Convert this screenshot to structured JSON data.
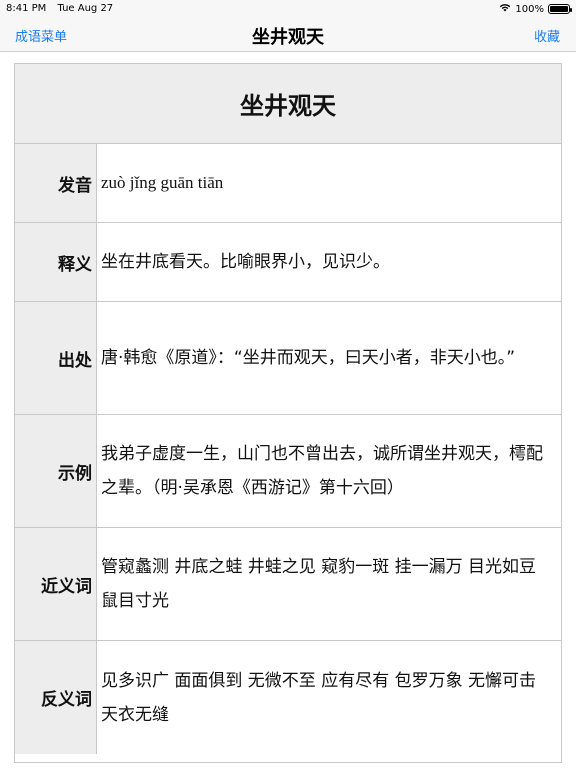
{
  "status_bar": {
    "time": "8:41 PM",
    "date": "Tue Aug 27",
    "battery": "100%",
    "battery_level": 1.0,
    "wifi_icon": "wifi-icon"
  },
  "nav": {
    "left_label": "成语菜单",
    "title": "坐井观天",
    "right_label": "收藏"
  },
  "idiom": {
    "title": "坐井观天",
    "rows": [
      {
        "label": "发音",
        "value": "zuò jǐng guān tiān"
      },
      {
        "label": "释义",
        "value": "坐在井底看天。比喻眼界小，见识少。"
      },
      {
        "label": "出处",
        "value": "唐·韩愈《原道》：“坐井而观天，曰天小者，非天小也。”"
      },
      {
        "label": "示例",
        "value": "我弟子虚度一生，山门也不曾出去，诚所谓坐井观天，樗配之辈。（明·吴承恩《西游记》第十六回）"
      },
      {
        "label": "近义词",
        "value": "管窥蠡测 井底之蛙 井蛙之见 窥豹一斑 挂一漏万 目光如豆 鼠目寸光"
      },
      {
        "label": "反义词",
        "value": "见多识广 面面俱到 无微不至 应有尽有 包罗万象 无懈可击 天衣无缝"
      }
    ]
  },
  "colors": {
    "accent": "#1b7cf6",
    "header_bg": "#ededed",
    "border": "#c8c8c8"
  }
}
